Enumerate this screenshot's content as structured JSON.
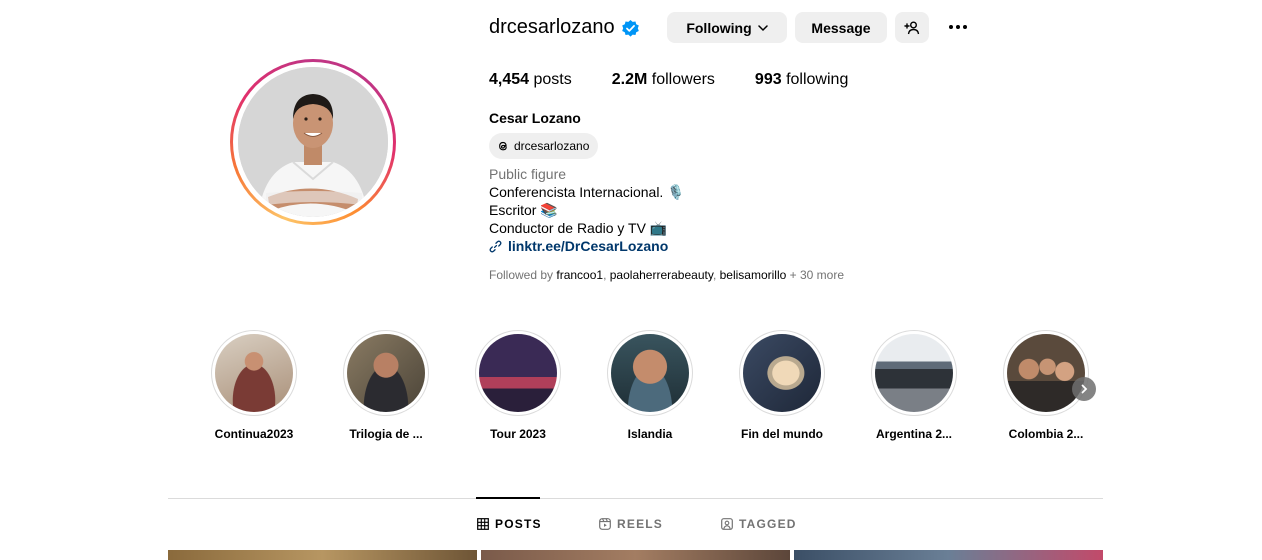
{
  "profile": {
    "username": "drcesarlozano",
    "full_name": "Cesar Lozano",
    "threads_handle": "drcesarlozano",
    "category": "Public figure",
    "bio_lines": [
      "Conferencista Internacional. 🎙️",
      "Escritor 📚",
      "Conductor de Radio y TV 📺"
    ],
    "link": "linktr.ee/DrCesarLozano"
  },
  "actions": {
    "following_label": "Following",
    "message_label": "Message"
  },
  "stats": {
    "posts": {
      "value": "4,454",
      "label": "posts"
    },
    "followers": {
      "value": "2.2M",
      "label": "followers"
    },
    "following": {
      "value": "993",
      "label": "following"
    }
  },
  "followed_by": {
    "prefix": "Followed by",
    "names": [
      "francoo1",
      "paolaherrerabeauty",
      "belisamorillo"
    ],
    "more": "+ 30 more"
  },
  "highlights": [
    {
      "label": "Continua2023"
    },
    {
      "label": "Trilogia de ..."
    },
    {
      "label": "Tour 2023"
    },
    {
      "label": "Islandia"
    },
    {
      "label": "Fin del mundo"
    },
    {
      "label": "Argentina 2..."
    },
    {
      "label": "Colombia 2..."
    }
  ],
  "tabs": {
    "posts": "POSTS",
    "reels": "REELS",
    "tagged": "TAGGED"
  },
  "colors": {
    "verified": "#0095f6",
    "link": "#00376b",
    "secondary_text": "#737373",
    "button_bg": "#efefef"
  },
  "icons": {
    "verified": "verified-badge-icon",
    "chevron": "chevron-down-icon",
    "add_user": "add-user-icon",
    "more": "more-options-icon",
    "threads": "threads-icon",
    "link": "link-icon",
    "posts": "grid-icon",
    "reels": "reels-icon",
    "tagged": "tagged-icon"
  }
}
